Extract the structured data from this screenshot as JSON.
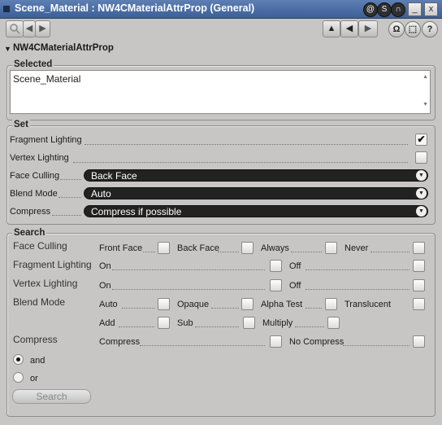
{
  "window": {
    "title": "Scene_Material : NW4CMaterialAttrProp (General)",
    "controls": [
      "@",
      "S",
      "∩",
      "_",
      "x"
    ]
  },
  "toolbar": {
    "nav_back": "◀",
    "nav_forward": "▶",
    "right_buttons": [
      "▲",
      "◀",
      "▶",
      "Ω",
      "⬚",
      "?"
    ]
  },
  "section": {
    "title": "NW4CMaterialAttrProp"
  },
  "selected": {
    "title": "Selected",
    "value": "Scene_Material"
  },
  "set": {
    "title": "Set",
    "fragment_lighting": {
      "label": "Fragment Lighting",
      "checked": true
    },
    "vertex_lighting": {
      "label": "Vertex Lighting",
      "checked": false
    },
    "face_culling": {
      "label": "Face Culling",
      "value": "Back Face"
    },
    "blend_mode": {
      "label": "Blend Mode",
      "value": "Auto"
    },
    "compress": {
      "label": "Compress",
      "value": "Compress if possible"
    }
  },
  "search": {
    "title": "Search",
    "face_culling": {
      "label": "Face Culling",
      "options": [
        "Front Face",
        "Back Face",
        "Always",
        "Never"
      ]
    },
    "fragment_lighting": {
      "label": "Fragment Lighting",
      "options": [
        "On",
        "Off"
      ]
    },
    "vertex_lighting": {
      "label": "Vertex Lighting",
      "options": [
        "On",
        "Off"
      ]
    },
    "blend_mode": {
      "label": "Blend Mode",
      "options": [
        "Auto",
        "Opaque",
        "Alpha Test",
        "Translucent",
        "Add",
        "Sub",
        "Multiply"
      ]
    },
    "compress": {
      "label": "Compress",
      "options": [
        "Compress",
        "No Compress"
      ]
    },
    "logic": {
      "and": "and",
      "or": "or",
      "selected": "and"
    },
    "button": "Search"
  }
}
